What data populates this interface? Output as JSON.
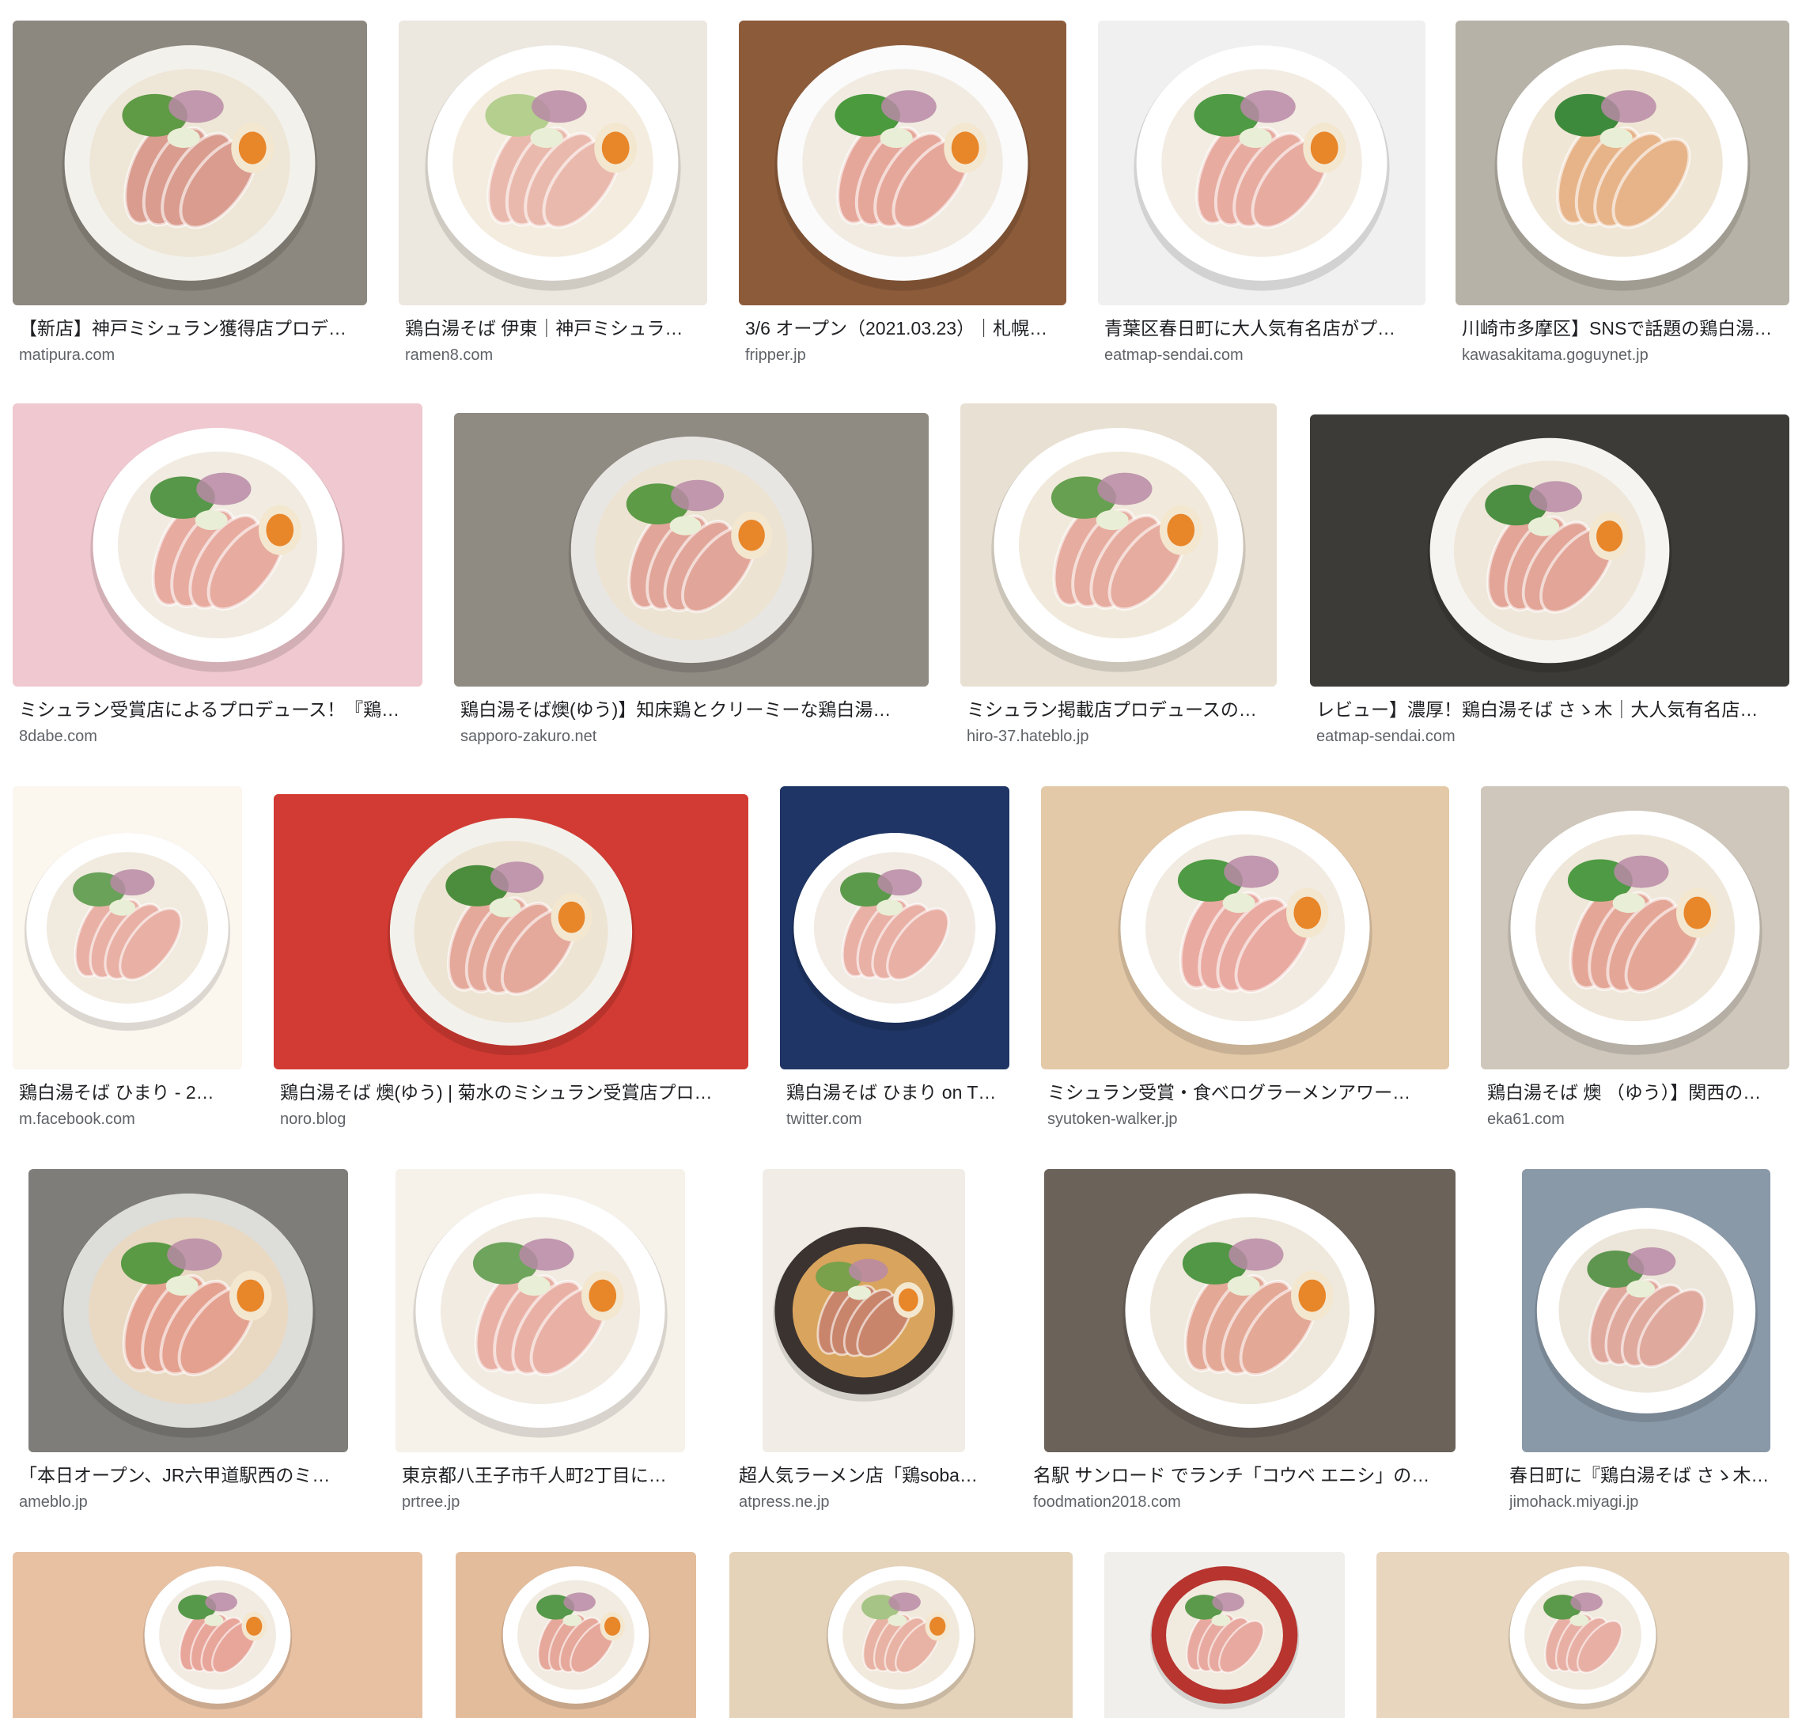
{
  "results": [
    {
      "title": "【新店】神戸ミシュラン獲得店プロデ…",
      "site": "matipura.com",
      "bg": "#8d887f",
      "bowl": "#f3f1ec",
      "broth": "#eee6d6",
      "meat": "#d99c8e",
      "herb": "#5f9a45",
      "egg": true
    },
    {
      "title": "鶏白湯そば 伊東｜神戸ミシュラ…",
      "site": "ramen8.com",
      "bg": "#ece7df",
      "bowl": "#ffffff",
      "broth": "#f3ecdf",
      "meat": "#eab9ad",
      "herb": "#b4cf8e",
      "egg": true
    },
    {
      "title": "3/6 オープン（2021.03.23）｜札幌…",
      "site": "fripper.jp",
      "bg": "#8c5b3a",
      "bowl": "#fbfbfb",
      "broth": "#f1ebe2",
      "meat": "#e6a79b",
      "herb": "#4b9a3e",
      "egg": true
    },
    {
      "title": "青葉区春日町に大人気有名店がプ…",
      "site": "eatmap-sendai.com",
      "bg": "#f0f0f0",
      "bowl": "#ffffff",
      "broth": "#f2ece2",
      "meat": "#e7aba0",
      "herb": "#4f9a44",
      "egg": true
    },
    {
      "title": "川崎市多摩区】SNSで話題の鶏白湯…",
      "site": "kawasakitama.goguynet.jp",
      "bg": "#b7b2a7",
      "bowl": "#ffffff",
      "broth": "#f0e6d6",
      "meat": "#e7b48a",
      "herb": "#3e8a3c",
      "egg": false
    },
    {
      "title": "ミシュラン受賞店によるプロデュース！『鶏…",
      "site": "8dabe.com",
      "bg": "#f0c8cf",
      "bowl": "#ffffff",
      "broth": "#f1ebe1",
      "meat": "#e7aba0",
      "herb": "#57974a",
      "egg": true
    },
    {
      "title": "鶏白湯そば燠(ゆう)】知床鶏とクリーミーな鶏白湯…",
      "site": "sapporo-zakuro.net",
      "bg": "#8f8a82",
      "bowl": "#e8e6e2",
      "broth": "#ece3d2",
      "meat": "#e1a699",
      "herb": "#5d9b47",
      "egg": true
    },
    {
      "title": "ミシュラン掲載店プロデュースの…",
      "site": "hiro-37.hateblo.jp",
      "bg": "#e8e0d2",
      "bowl": "#ffffff",
      "broth": "#f1eadc",
      "meat": "#e6ac9f",
      "herb": "#67a050",
      "egg": true
    },
    {
      "title": "レビュー】濃厚！鶏白湯そば さゝ木｜大人気有名店…",
      "site": "eatmap-sendai.com",
      "bg": "#3d3b37",
      "bowl": "#f6f4f0",
      "broth": "#efe7da",
      "meat": "#e2a597",
      "herb": "#4c8f42",
      "egg": true
    },
    {
      "title": "鶏白湯そば ひまり - 2…",
      "site": "m.facebook.com",
      "bg": "#fbf6ee",
      "bowl": "#ffffff",
      "broth": "#f1eadf",
      "meat": "#e9b1a6",
      "herb": "#6aa25a",
      "egg": false
    },
    {
      "title": "鶏白湯そば 燠(ゆう) | 菊水のミシュラン受賞店プロ…",
      "site": "noro.blog",
      "bg": "#d23b33",
      "bowl": "#f3f1ec",
      "broth": "#ede4d3",
      "meat": "#e4a99b",
      "herb": "#4c8d3d",
      "egg": true
    },
    {
      "title": "鶏白湯そば ひまり on T…",
      "site": "twitter.com",
      "bg": "#1f3565",
      "bowl": "#ffffff",
      "broth": "#f1ebe3",
      "meat": "#e9b0a6",
      "herb": "#5c9a4b",
      "egg": false
    },
    {
      "title": "ミシュラン受賞・食べログラーメンアワー…",
      "site": "syutoken-walker.jp",
      "bg": "#e3c9a8",
      "bowl": "#ffffff",
      "broth": "#f2ebe1",
      "meat": "#e9aaa1",
      "herb": "#4f9a44",
      "egg": true
    },
    {
      "title": "鶏白湯そば 燠 （ゆう）】関西の…",
      "site": "eka61.com",
      "bg": "#cfc7bb",
      "bowl": "#ffffff",
      "broth": "#efe7da",
      "meat": "#e4a697",
      "herb": "#4f9a44",
      "egg": true
    },
    {
      "title": "「本日オープン、JR六甲道駅西のミ…",
      "site": "ameblo.jp",
      "bg": "#7e7d79",
      "bowl": "#ddddd9",
      "broth": "#e9d9c3",
      "meat": "#e4a18f",
      "herb": "#5a9a44",
      "egg": true
    },
    {
      "title": "東京都八王子市千人町2丁目に…",
      "site": "prtree.jp",
      "bg": "#f6f2ea",
      "bowl": "#ffffff",
      "broth": "#f1ebe2",
      "meat": "#e9b1a6",
      "herb": "#6fa45d",
      "egg": true
    },
    {
      "title": "超人気ラーメン店「鶏soba…",
      "site": "atpress.ne.jp",
      "bg": "#f1ede6",
      "bowl": "#3a3330",
      "broth": "#d9a45d",
      "meat": "#c9856b",
      "herb": "#79a04b",
      "egg": true
    },
    {
      "title": "名駅 サンロード でランチ「コウベ エニシ」の…",
      "site": "foodmation2018.com",
      "bg": "#6b625a",
      "bowl": "#ffffff",
      "broth": "#efe8dc",
      "meat": "#e3a896",
      "herb": "#519745",
      "egg": true
    },
    {
      "title": "春日町に『鶏白湯そば さゝ木…",
      "site": "jimohack.miyagi.jp",
      "bg": "#8a99a8",
      "bowl": "#ffffff",
      "broth": "#ece5da",
      "meat": "#e0a99d",
      "herb": "#5e9650",
      "egg": false
    },
    {
      "title": "",
      "site": "",
      "bg": "#e8c1a3",
      "bowl": "#ffffff",
      "broth": "#f2ebe2",
      "meat": "#e8a69b",
      "herb": "#56994a",
      "egg": true
    },
    {
      "title": "",
      "site": "",
      "bg": "#e3bc9b",
      "bowl": "#ffffff",
      "broth": "#f2ebe1",
      "meat": "#e6a89b",
      "herb": "#56994a",
      "egg": true
    },
    {
      "title": "",
      "site": "",
      "bg": "#e4d2b9",
      "bowl": "#ffffff",
      "broth": "#f1e9dc",
      "meat": "#e8b3a4",
      "herb": "#a6c485",
      "egg": true
    },
    {
      "title": "",
      "site": "",
      "bg": "#f1efec",
      "bowl": "#b8342f",
      "broth": "#f1eadf",
      "meat": "#e8aaa0",
      "herb": "#5b9a4b",
      "egg": false
    },
    {
      "title": "",
      "site": "",
      "bg": "#e8d6bf",
      "bowl": "#ffffff",
      "broth": "#f1eadf",
      "meat": "#e8b0a5",
      "herb": "#5b9a4b",
      "egg": false
    }
  ]
}
